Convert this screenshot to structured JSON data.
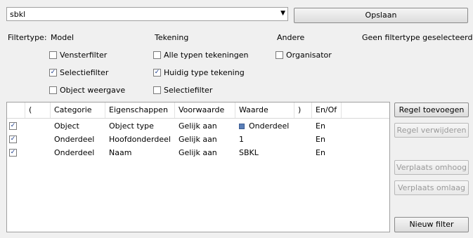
{
  "filter_name": "sbkl",
  "save_label": "Opslaan",
  "filtertype": {
    "label": "Filtertype:",
    "model_header": "Model",
    "drawing_header": "Tekening",
    "other_header": "Andere",
    "status": "Geen filtertype geselecteerd",
    "model_options": [
      {
        "label": "Vensterfilter",
        "checked": false
      },
      {
        "label": "Selectiefilter",
        "checked": true
      },
      {
        "label": "Object weergave",
        "checked": false
      }
    ],
    "drawing_options": [
      {
        "label": "Alle typen tekeningen",
        "checked": false
      },
      {
        "label": "Huidig type tekening",
        "checked": true
      },
      {
        "label": "Selectiefilter",
        "checked": false
      }
    ],
    "other_options": [
      {
        "label": "Organisator",
        "checked": false
      }
    ]
  },
  "table": {
    "columns": [
      "(",
      "Categorie",
      "Eigenschappen",
      "Voorwaarde",
      "Waarde",
      ")",
      "En/Of"
    ],
    "rows": [
      {
        "checked": true,
        "open": "",
        "categorie": "Object",
        "eigenschappen": "Object type",
        "voorwaarde": "Gelijk aan",
        "waarde": "Onderdeel",
        "close": "",
        "enof": "En"
      },
      {
        "checked": true,
        "open": "",
        "categorie": "Onderdeel",
        "eigenschappen": "Hoofdonderdeel",
        "voorwaarde": "Gelijk aan",
        "waarde": "1",
        "close": "",
        "enof": "En"
      },
      {
        "checked": true,
        "open": "",
        "categorie": "Onderdeel",
        "eigenschappen": "Naam",
        "voorwaarde": "Gelijk aan",
        "waarde": "SBKL",
        "close": "",
        "enof": "En"
      }
    ]
  },
  "buttons": {
    "add_rule": "Regel toevoegen",
    "remove_rule": "Regel verwijderen",
    "move_up": "Verplaats omhoog",
    "move_down": "Verplaats omlaag",
    "new_filter": "Nieuw filter"
  }
}
